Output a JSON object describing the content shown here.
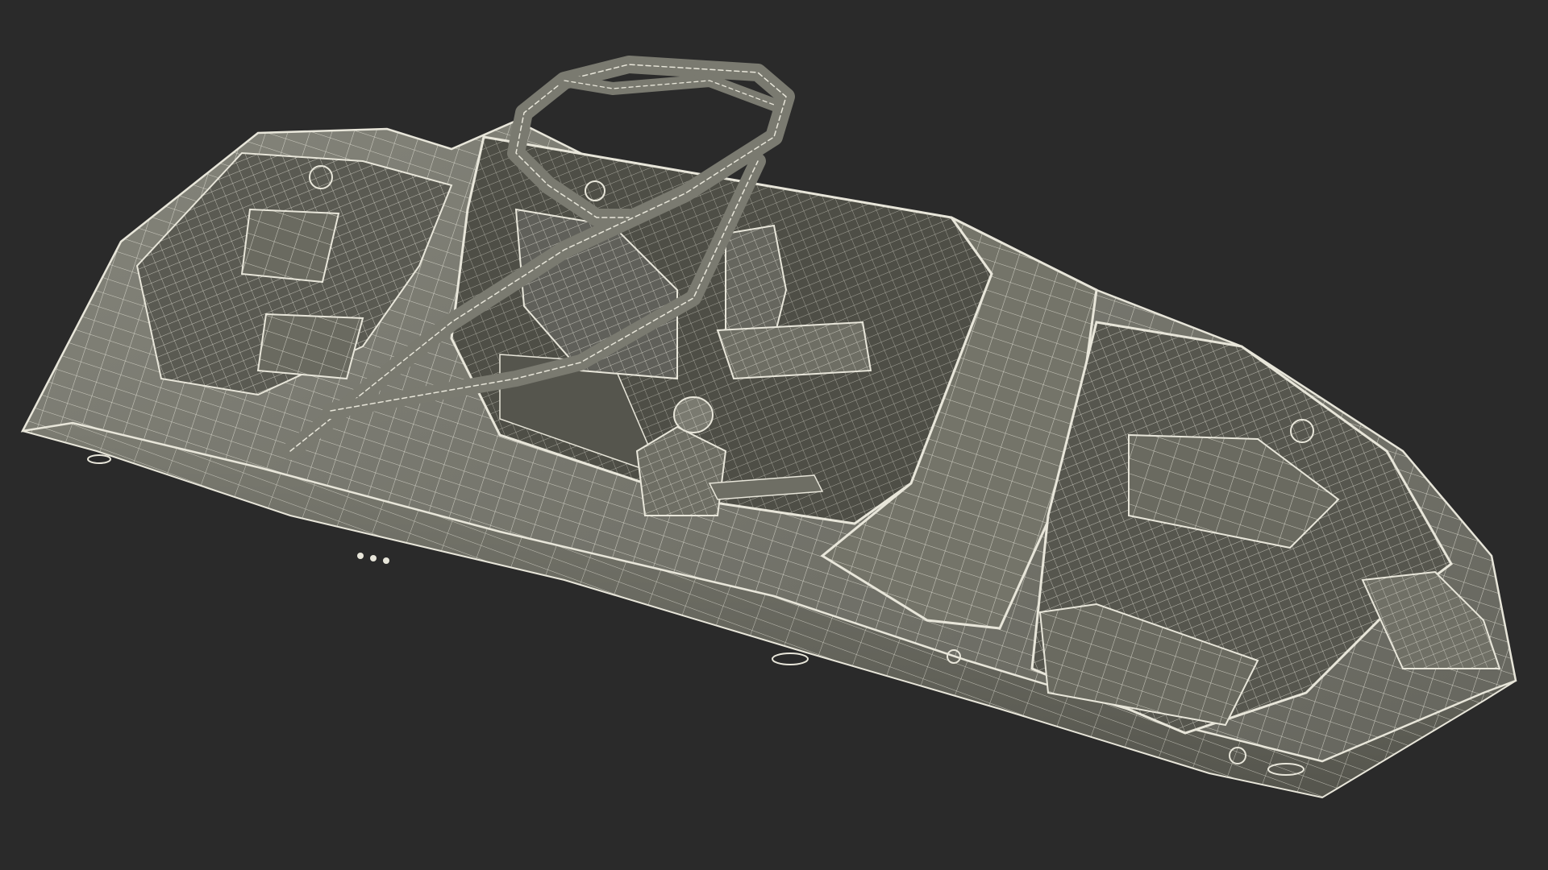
{
  "scene": {
    "background_color": "#2a2a2a",
    "hull_color": "#6e6e64",
    "hull_shadow_color": "#4e4e46",
    "interior_color": "#5a5a52",
    "wire_color": "#e8e6da",
    "subject": "wireframe-boat-render"
  }
}
